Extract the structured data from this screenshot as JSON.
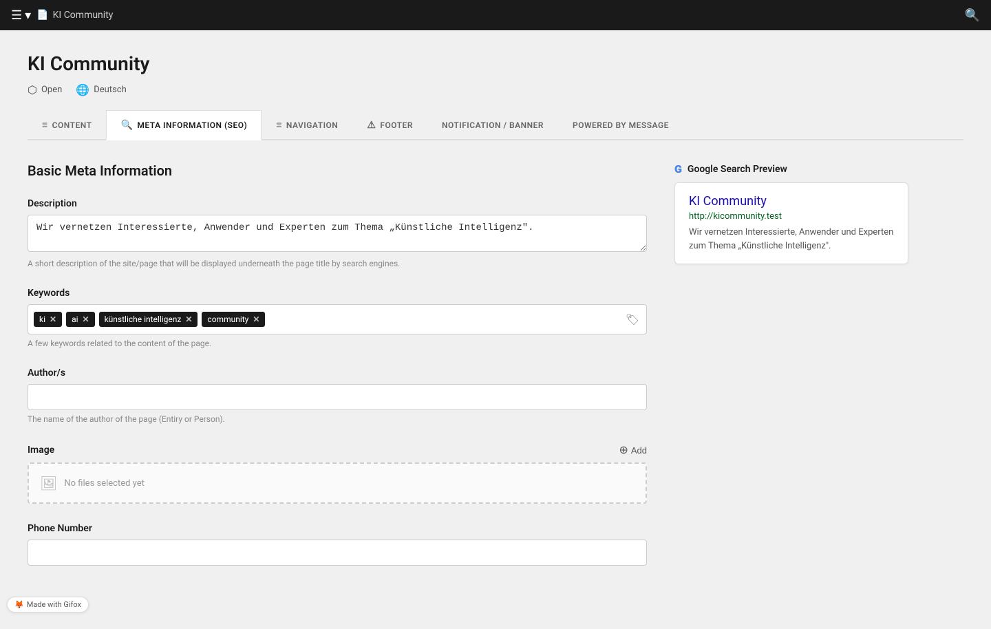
{
  "topbar": {
    "title": "KI Community",
    "menu_icon": "☰",
    "chevron_icon": "▾",
    "doc_icon": "📄",
    "search_icon": "🔍"
  },
  "page": {
    "title": "KI Community",
    "status": {
      "open_label": "Open",
      "lang_label": "Deutsch",
      "open_icon": "⬡",
      "lang_icon": "🌐"
    },
    "tabs": [
      {
        "id": "content",
        "label": "CONTENT",
        "icon": "≡",
        "active": false
      },
      {
        "id": "meta",
        "label": "META INFORMATION (SEO)",
        "icon": "🔍",
        "active": true
      },
      {
        "id": "navigation",
        "label": "NAVIGATION",
        "icon": "≡",
        "active": false
      },
      {
        "id": "footer",
        "label": "FOOTER",
        "icon": "⚠",
        "active": false
      },
      {
        "id": "notification",
        "label": "NOTIFICATION / BANNER",
        "active": false
      },
      {
        "id": "powered",
        "label": "POWERED BY MESSAGE",
        "active": false
      }
    ]
  },
  "meta_section": {
    "heading": "Basic Meta Information",
    "description": {
      "label": "Description",
      "value": "Wir vernetzen Interessierte, Anwender und Experten zum Thema „Künstliche Intelligenz\".",
      "hint": "A short description of the site/page that will be displayed underneath the page title by search engines."
    },
    "keywords": {
      "label": "Keywords",
      "hint": "A few keywords related to the content of the page.",
      "tags": [
        {
          "text": "ki"
        },
        {
          "text": "ai"
        },
        {
          "text": "künstliche intelligenz"
        },
        {
          "text": "community"
        }
      ]
    },
    "authors": {
      "label": "Author/s",
      "value": "",
      "hint": "The name of the author of the page (Entiry or Person)."
    },
    "image": {
      "label": "Image",
      "add_label": "Add",
      "no_files": "No files selected yet"
    },
    "phone": {
      "label": "Phone Number",
      "value": ""
    }
  },
  "google_preview": {
    "heading": "Google Search Preview",
    "title": "KI Community",
    "url": "http://kicommunity.test",
    "description": "Wir vernetzen Interessierte, Anwender und Experten zum Thema „Künstliche Intelligenz\"."
  },
  "gifox": {
    "label": "Made with Gifox"
  }
}
